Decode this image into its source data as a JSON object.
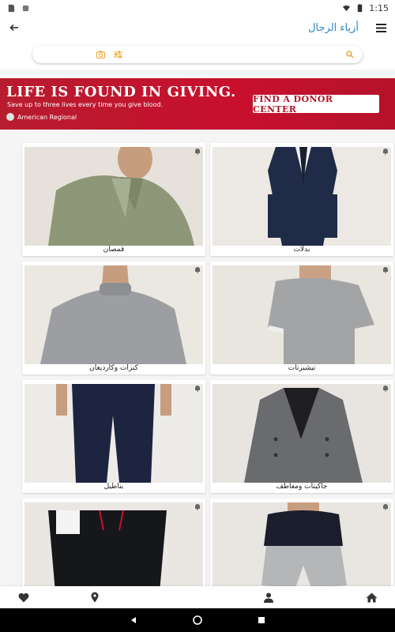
{
  "status_bar": {
    "time": "1:15"
  },
  "app_bar": {
    "title": "أزياء الرجال",
    "back_icon": "arrow-left-icon",
    "menu_icon": "menu-icon"
  },
  "search": {
    "placeholder": "",
    "value": ""
  },
  "banner": {
    "headline": "LIFE IS FOUND IN GIVING.",
    "subline": "Save up to three lives every time you give blood.",
    "brand": "American Regional",
    "cta": "FIND A DONOR CENTER",
    "colors": {
      "background": "#c8102e",
      "cta_text": "#b01528"
    }
  },
  "categories": [
    {
      "label": "بدلات"
    },
    {
      "label": "قمصان"
    },
    {
      "label": "تيشيرتات"
    },
    {
      "label": "كنزات وكارديغان"
    },
    {
      "label": "جاكيتات ومعاطف"
    },
    {
      "label": "بناطيل"
    },
    {
      "label": ""
    },
    {
      "label": ""
    }
  ],
  "bottom_nav": [
    "home-icon",
    "account-icon",
    "location-icon",
    "favorites-icon"
  ],
  "colors": {
    "accent": "#2c87c7",
    "search_icon": "#f0a020"
  }
}
